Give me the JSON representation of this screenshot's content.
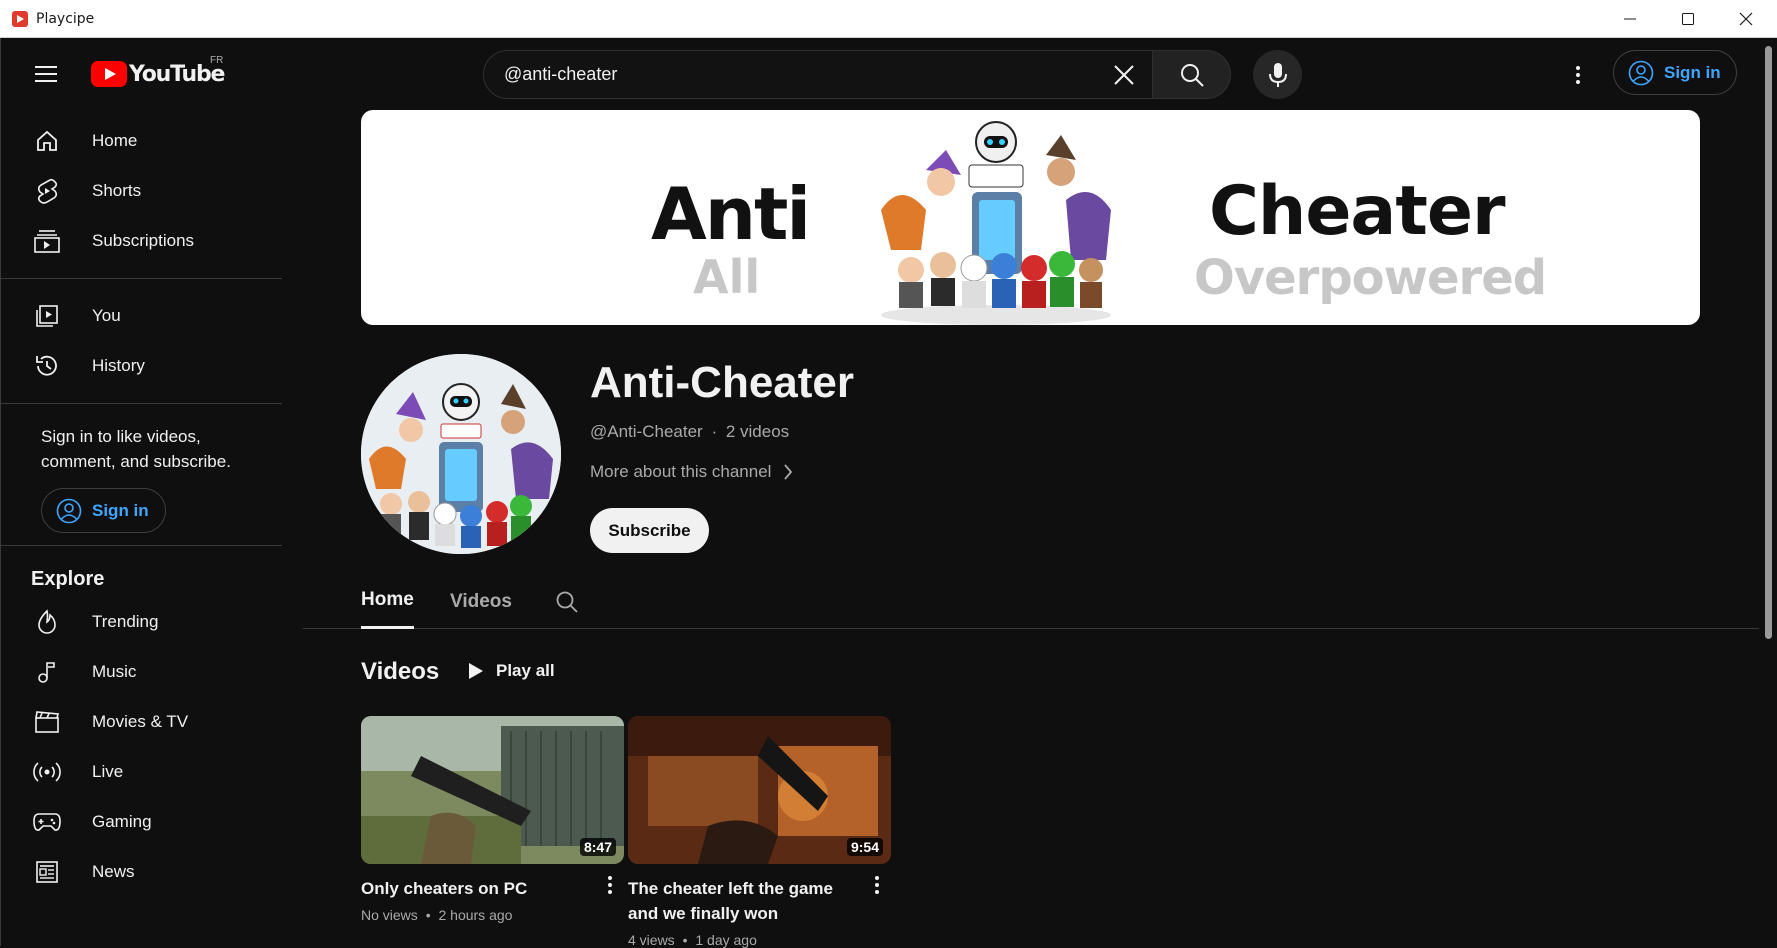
{
  "window": {
    "title": "Playcipe"
  },
  "header": {
    "logo_word": "YouTube",
    "country_code": "FR",
    "search_value": "@anti-cheater",
    "signin_label": "Sign in"
  },
  "sidebar": {
    "primary": [
      {
        "label": "Home",
        "icon": "home-icon"
      },
      {
        "label": "Shorts",
        "icon": "shorts-icon"
      },
      {
        "label": "Subscriptions",
        "icon": "subscriptions-icon"
      }
    ],
    "secondary": [
      {
        "label": "You",
        "icon": "you-icon"
      },
      {
        "label": "History",
        "icon": "history-icon"
      }
    ],
    "signin_prompt": "Sign in to like videos, comment, and subscribe.",
    "signin_label": "Sign in",
    "explore_heading": "Explore",
    "explore": [
      {
        "label": "Trending",
        "icon": "trending-icon"
      },
      {
        "label": "Music",
        "icon": "music-icon"
      },
      {
        "label": "Movies & TV",
        "icon": "movies-icon"
      },
      {
        "label": "Live",
        "icon": "live-icon"
      },
      {
        "label": "Gaming",
        "icon": "gaming-icon"
      },
      {
        "label": "News",
        "icon": "news-icon"
      }
    ]
  },
  "banner": {
    "word1": "Anti",
    "word1_sub": "All",
    "word2": "Cheater",
    "word2_sub": "Overpowered"
  },
  "channel": {
    "name": "Anti-Cheater",
    "handle": "@Anti-Cheater",
    "meta_separator": "·",
    "video_count": "2 videos",
    "more_label": "More about this channel",
    "subscribe_label": "Subscribe"
  },
  "tabs": [
    {
      "label": "Home",
      "active": true
    },
    {
      "label": "Videos",
      "active": false
    }
  ],
  "shelf": {
    "title": "Videos",
    "play_all_label": "Play all",
    "videos": [
      {
        "title": "Only cheaters on PC",
        "duration": "8:47",
        "views": "No views",
        "age": "2 hours ago"
      },
      {
        "title": "The cheater left the game and we finally won",
        "duration": "9:54",
        "views": "4 views",
        "age": "1 day ago"
      }
    ],
    "meta_separator": "•"
  },
  "colors": {
    "background": "#0f0f0f",
    "accent_blue": "#3ea6ff",
    "brand_red": "#ff0000",
    "text_secondary": "#aaaaaa"
  }
}
